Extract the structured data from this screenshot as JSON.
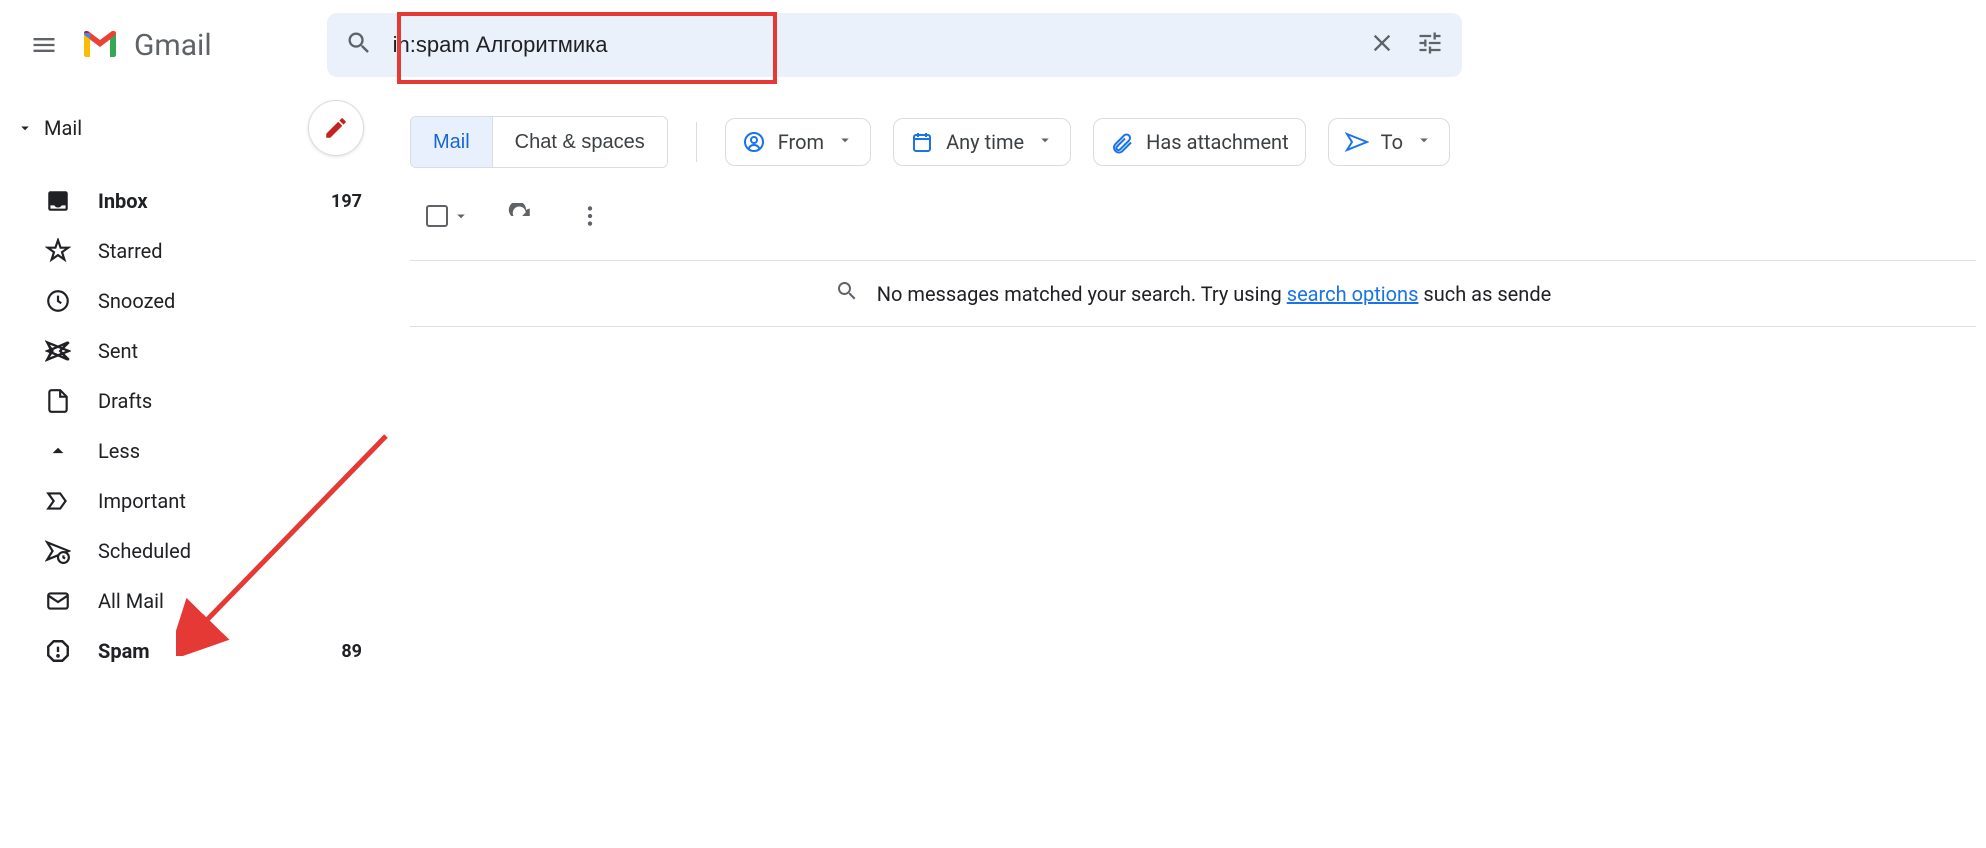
{
  "header": {
    "app_name": "Gmail",
    "search_value": "in:spam Алгоритмика"
  },
  "sidebar": {
    "category_label": "Mail",
    "items": [
      {
        "label": "Inbox",
        "count": "197",
        "bold": true
      },
      {
        "label": "Starred",
        "count": "",
        "bold": false
      },
      {
        "label": "Snoozed",
        "count": "",
        "bold": false
      },
      {
        "label": "Sent",
        "count": "",
        "bold": false
      },
      {
        "label": "Drafts",
        "count": "",
        "bold": false
      },
      {
        "label": "Less",
        "count": "",
        "bold": false
      },
      {
        "label": "Important",
        "count": "",
        "bold": false
      },
      {
        "label": "Scheduled",
        "count": "",
        "bold": false
      },
      {
        "label": "All Mail",
        "count": "",
        "bold": false
      },
      {
        "label": "Spam",
        "count": "89",
        "bold": true
      }
    ]
  },
  "scope": {
    "mail": "Mail",
    "chat": "Chat & spaces"
  },
  "chips": {
    "from": "From",
    "anytime": "Any time",
    "attachment": "Has attachment",
    "to": "To"
  },
  "empty": {
    "pre": "No messages matched your search. Try using ",
    "link": "search options",
    "post": " such as sende"
  }
}
